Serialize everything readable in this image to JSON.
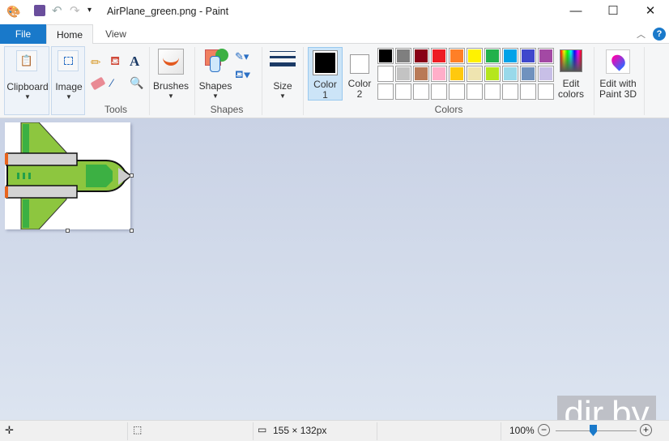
{
  "window": {
    "title": "AirPlane_green.png - Paint",
    "minimize": "—",
    "maximize": "☐",
    "close": "✕"
  },
  "tabs": {
    "file": "File",
    "home": "Home",
    "view": "View"
  },
  "ribbon": {
    "clipboard": "Clipboard",
    "image": "Image",
    "tools": "Tools",
    "brushes": "Brushes",
    "shapes": "Shapes",
    "shapes_group": "Shapes",
    "size": "Size",
    "color1": "Color",
    "color1_num": "1",
    "color2": "Color",
    "color2_num": "2",
    "colors_group": "Colors",
    "edit_colors": [
      "Edit",
      "colors"
    ],
    "paint3d": [
      "Edit with",
      "Paint 3D"
    ],
    "help": "?"
  },
  "palette": [
    [
      "#000000",
      "#7f7f7f",
      "#880015",
      "#ed1c24",
      "#ff7f27",
      "#fff200",
      "#22b14c",
      "#00a2e8",
      "#3f48cc",
      "#a349a4"
    ],
    [
      "#ffffff",
      "#c3c3c3",
      "#b97a57",
      "#ffaec9",
      "#ffc90e",
      "#efe4b0",
      "#b5e61d",
      "#99d9ea",
      "#7092be",
      "#c8bfe7"
    ],
    [
      "#ffffff",
      "#ffffff",
      "#ffffff",
      "#ffffff",
      "#ffffff",
      "#ffffff",
      "#ffffff",
      "#ffffff",
      "#ffffff",
      "#ffffff"
    ]
  ],
  "color1_value": "#000000",
  "color2_value": "#ffffff",
  "status": {
    "image_size": "155 × 132px",
    "zoom": "100%"
  },
  "watermark": "dir.by"
}
